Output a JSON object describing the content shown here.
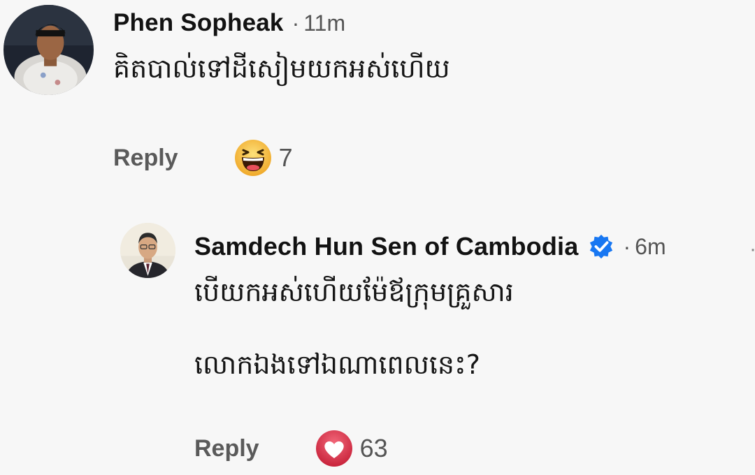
{
  "comments": [
    {
      "author": "Phen Sopheak",
      "time": "11m",
      "text": "គិតបាល់ទៅដីសៀមយកអស់ហើយ",
      "reply_label": "Reply",
      "reaction": {
        "icon": "haha-emoji-icon",
        "count": "7"
      }
    },
    {
      "author": "Samdech Hun Sen of Cambodia",
      "verified": true,
      "time": "6m",
      "text_line1": "បើយកអស់ហើយម៉ែឪក្រុមគ្រួសារ",
      "text_line2": "លោកឯងទៅឯណាពេលនេះ?",
      "reply_label": "Reply",
      "reaction": {
        "icon": "love-heart-icon",
        "count": "63"
      }
    }
  ],
  "separator": "·",
  "colors": {
    "background": "#f7f7f7",
    "verified_blue": "#1877f2",
    "haha_yellow": "#f7c843",
    "love_red": "#e2344e"
  }
}
